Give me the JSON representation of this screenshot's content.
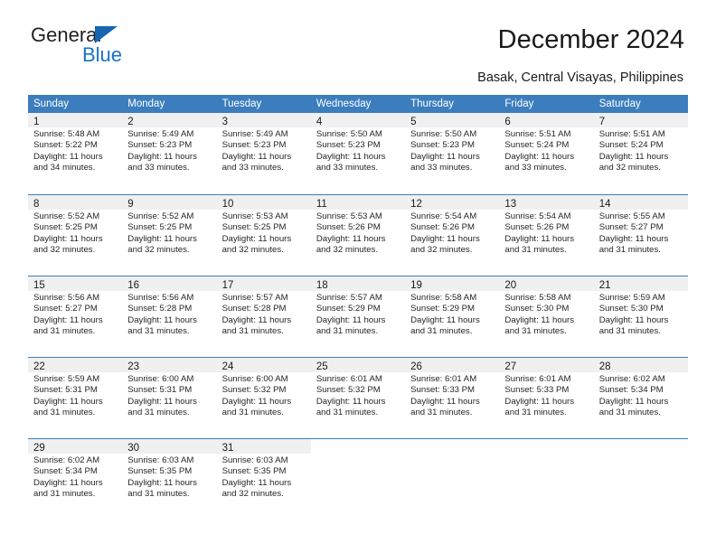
{
  "header": {
    "logo": {
      "primary": "General",
      "secondary": "Blue",
      "triangle_icon": "blue-triangle-icon"
    },
    "title": "December 2024",
    "subtitle": "Basak, Central Visayas, Philippines"
  },
  "colors": {
    "header_row_bg": "#3c7ebd",
    "daynum_band_bg": "#f0f0f0",
    "logo_blue": "#1a73c4",
    "text": "#1a1a1a"
  },
  "calendar": {
    "weekday_headers": [
      "Sunday",
      "Monday",
      "Tuesday",
      "Wednesday",
      "Thursday",
      "Friday",
      "Saturday"
    ],
    "weeks": [
      [
        {
          "day": "1",
          "sunrise": "Sunrise: 5:48 AM",
          "sunset": "Sunset: 5:22 PM",
          "daylight_line1": "Daylight: 11 hours",
          "daylight_line2": "and 34 minutes."
        },
        {
          "day": "2",
          "sunrise": "Sunrise: 5:49 AM",
          "sunset": "Sunset: 5:23 PM",
          "daylight_line1": "Daylight: 11 hours",
          "daylight_line2": "and 33 minutes."
        },
        {
          "day": "3",
          "sunrise": "Sunrise: 5:49 AM",
          "sunset": "Sunset: 5:23 PM",
          "daylight_line1": "Daylight: 11 hours",
          "daylight_line2": "and 33 minutes."
        },
        {
          "day": "4",
          "sunrise": "Sunrise: 5:50 AM",
          "sunset": "Sunset: 5:23 PM",
          "daylight_line1": "Daylight: 11 hours",
          "daylight_line2": "and 33 minutes."
        },
        {
          "day": "5",
          "sunrise": "Sunrise: 5:50 AM",
          "sunset": "Sunset: 5:23 PM",
          "daylight_line1": "Daylight: 11 hours",
          "daylight_line2": "and 33 minutes."
        },
        {
          "day": "6",
          "sunrise": "Sunrise: 5:51 AM",
          "sunset": "Sunset: 5:24 PM",
          "daylight_line1": "Daylight: 11 hours",
          "daylight_line2": "and 33 minutes."
        },
        {
          "day": "7",
          "sunrise": "Sunrise: 5:51 AM",
          "sunset": "Sunset: 5:24 PM",
          "daylight_line1": "Daylight: 11 hours",
          "daylight_line2": "and 32 minutes."
        }
      ],
      [
        {
          "day": "8",
          "sunrise": "Sunrise: 5:52 AM",
          "sunset": "Sunset: 5:25 PM",
          "daylight_line1": "Daylight: 11 hours",
          "daylight_line2": "and 32 minutes."
        },
        {
          "day": "9",
          "sunrise": "Sunrise: 5:52 AM",
          "sunset": "Sunset: 5:25 PM",
          "daylight_line1": "Daylight: 11 hours",
          "daylight_line2": "and 32 minutes."
        },
        {
          "day": "10",
          "sunrise": "Sunrise: 5:53 AM",
          "sunset": "Sunset: 5:25 PM",
          "daylight_line1": "Daylight: 11 hours",
          "daylight_line2": "and 32 minutes."
        },
        {
          "day": "11",
          "sunrise": "Sunrise: 5:53 AM",
          "sunset": "Sunset: 5:26 PM",
          "daylight_line1": "Daylight: 11 hours",
          "daylight_line2": "and 32 minutes."
        },
        {
          "day": "12",
          "sunrise": "Sunrise: 5:54 AM",
          "sunset": "Sunset: 5:26 PM",
          "daylight_line1": "Daylight: 11 hours",
          "daylight_line2": "and 32 minutes."
        },
        {
          "day": "13",
          "sunrise": "Sunrise: 5:54 AM",
          "sunset": "Sunset: 5:26 PM",
          "daylight_line1": "Daylight: 11 hours",
          "daylight_line2": "and 31 minutes."
        },
        {
          "day": "14",
          "sunrise": "Sunrise: 5:55 AM",
          "sunset": "Sunset: 5:27 PM",
          "daylight_line1": "Daylight: 11 hours",
          "daylight_line2": "and 31 minutes."
        }
      ],
      [
        {
          "day": "15",
          "sunrise": "Sunrise: 5:56 AM",
          "sunset": "Sunset: 5:27 PM",
          "daylight_line1": "Daylight: 11 hours",
          "daylight_line2": "and 31 minutes."
        },
        {
          "day": "16",
          "sunrise": "Sunrise: 5:56 AM",
          "sunset": "Sunset: 5:28 PM",
          "daylight_line1": "Daylight: 11 hours",
          "daylight_line2": "and 31 minutes."
        },
        {
          "day": "17",
          "sunrise": "Sunrise: 5:57 AM",
          "sunset": "Sunset: 5:28 PM",
          "daylight_line1": "Daylight: 11 hours",
          "daylight_line2": "and 31 minutes."
        },
        {
          "day": "18",
          "sunrise": "Sunrise: 5:57 AM",
          "sunset": "Sunset: 5:29 PM",
          "daylight_line1": "Daylight: 11 hours",
          "daylight_line2": "and 31 minutes."
        },
        {
          "day": "19",
          "sunrise": "Sunrise: 5:58 AM",
          "sunset": "Sunset: 5:29 PM",
          "daylight_line1": "Daylight: 11 hours",
          "daylight_line2": "and 31 minutes."
        },
        {
          "day": "20",
          "sunrise": "Sunrise: 5:58 AM",
          "sunset": "Sunset: 5:30 PM",
          "daylight_line1": "Daylight: 11 hours",
          "daylight_line2": "and 31 minutes."
        },
        {
          "day": "21",
          "sunrise": "Sunrise: 5:59 AM",
          "sunset": "Sunset: 5:30 PM",
          "daylight_line1": "Daylight: 11 hours",
          "daylight_line2": "and 31 minutes."
        }
      ],
      [
        {
          "day": "22",
          "sunrise": "Sunrise: 5:59 AM",
          "sunset": "Sunset: 5:31 PM",
          "daylight_line1": "Daylight: 11 hours",
          "daylight_line2": "and 31 minutes."
        },
        {
          "day": "23",
          "sunrise": "Sunrise: 6:00 AM",
          "sunset": "Sunset: 5:31 PM",
          "daylight_line1": "Daylight: 11 hours",
          "daylight_line2": "and 31 minutes."
        },
        {
          "day": "24",
          "sunrise": "Sunrise: 6:00 AM",
          "sunset": "Sunset: 5:32 PM",
          "daylight_line1": "Daylight: 11 hours",
          "daylight_line2": "and 31 minutes."
        },
        {
          "day": "25",
          "sunrise": "Sunrise: 6:01 AM",
          "sunset": "Sunset: 5:32 PM",
          "daylight_line1": "Daylight: 11 hours",
          "daylight_line2": "and 31 minutes."
        },
        {
          "day": "26",
          "sunrise": "Sunrise: 6:01 AM",
          "sunset": "Sunset: 5:33 PM",
          "daylight_line1": "Daylight: 11 hours",
          "daylight_line2": "and 31 minutes."
        },
        {
          "day": "27",
          "sunrise": "Sunrise: 6:01 AM",
          "sunset": "Sunset: 5:33 PM",
          "daylight_line1": "Daylight: 11 hours",
          "daylight_line2": "and 31 minutes."
        },
        {
          "day": "28",
          "sunrise": "Sunrise: 6:02 AM",
          "sunset": "Sunset: 5:34 PM",
          "daylight_line1": "Daylight: 11 hours",
          "daylight_line2": "and 31 minutes."
        }
      ],
      [
        {
          "day": "29",
          "sunrise": "Sunrise: 6:02 AM",
          "sunset": "Sunset: 5:34 PM",
          "daylight_line1": "Daylight: 11 hours",
          "daylight_line2": "and 31 minutes."
        },
        {
          "day": "30",
          "sunrise": "Sunrise: 6:03 AM",
          "sunset": "Sunset: 5:35 PM",
          "daylight_line1": "Daylight: 11 hours",
          "daylight_line2": "and 31 minutes."
        },
        {
          "day": "31",
          "sunrise": "Sunrise: 6:03 AM",
          "sunset": "Sunset: 5:35 PM",
          "daylight_line1": "Daylight: 11 hours",
          "daylight_line2": "and 32 minutes."
        },
        {
          "day": "",
          "sunrise": "",
          "sunset": "",
          "daylight_line1": "",
          "daylight_line2": ""
        },
        {
          "day": "",
          "sunrise": "",
          "sunset": "",
          "daylight_line1": "",
          "daylight_line2": ""
        },
        {
          "day": "",
          "sunrise": "",
          "sunset": "",
          "daylight_line1": "",
          "daylight_line2": ""
        },
        {
          "day": "",
          "sunrise": "",
          "sunset": "",
          "daylight_line1": "",
          "daylight_line2": ""
        }
      ]
    ]
  }
}
